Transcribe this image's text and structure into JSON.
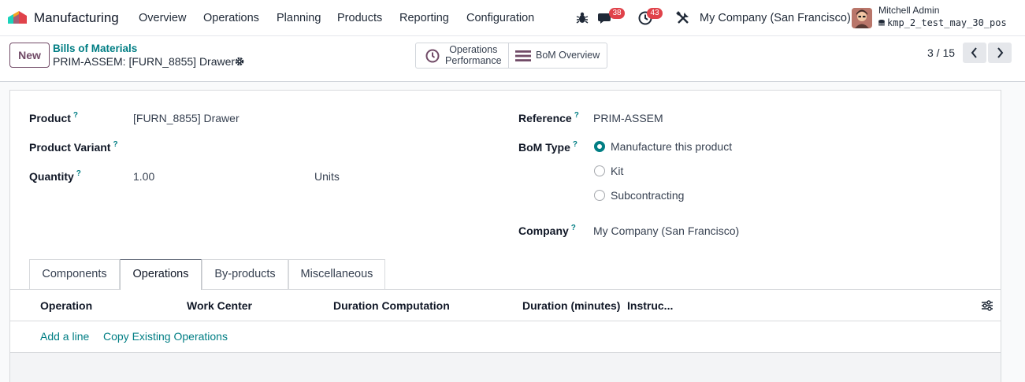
{
  "navbar": {
    "app_name": "Manufacturing",
    "menu": [
      "Overview",
      "Operations",
      "Planning",
      "Products",
      "Reporting",
      "Configuration"
    ],
    "messages_count": "38",
    "activities_count": "43",
    "company": "My Company (San Francisco)",
    "user_name": "Mitchell Admin",
    "database": "kmp_2_test_may_30_pos"
  },
  "control_panel": {
    "new_label": "New",
    "breadcrumb": "Bills of Materials",
    "record_title": "PRIM-ASSEM: [FURN_8855] Drawer",
    "smart_buttons": {
      "operations_line1": "Operations",
      "operations_line2": "Performance",
      "bom_overview": "BoM Overview"
    },
    "pager": "3 / 15"
  },
  "form": {
    "product_label": "Product",
    "product_value": "[FURN_8855] Drawer",
    "variant_label": "Product Variant",
    "quantity_label": "Quantity",
    "quantity_value": "1.00",
    "uom_value": "Units",
    "reference_label": "Reference",
    "reference_value": "PRIM-ASSEM",
    "bom_type_label": "BoM Type",
    "bom_type_options": [
      "Manufacture this product",
      "Kit",
      "Subcontracting"
    ],
    "bom_type_selected": "Manufacture this product",
    "company_label": "Company",
    "company_value": "My Company (San Francisco)",
    "help_mark": "?"
  },
  "tabs": [
    {
      "label": "Components",
      "active": false
    },
    {
      "label": "Operations",
      "active": true
    },
    {
      "label": "By-products",
      "active": false
    },
    {
      "label": "Miscellaneous",
      "active": false
    }
  ],
  "operations_list": {
    "columns": [
      "Operation",
      "Work Center",
      "Duration Computation",
      "Duration (minutes)",
      "Instruc..."
    ],
    "add_line": "Add a line",
    "copy_existing": "Copy Existing Operations"
  },
  "colors": {
    "brand": "#714b67",
    "accent": "#017e84",
    "badge": "#e0424a"
  }
}
